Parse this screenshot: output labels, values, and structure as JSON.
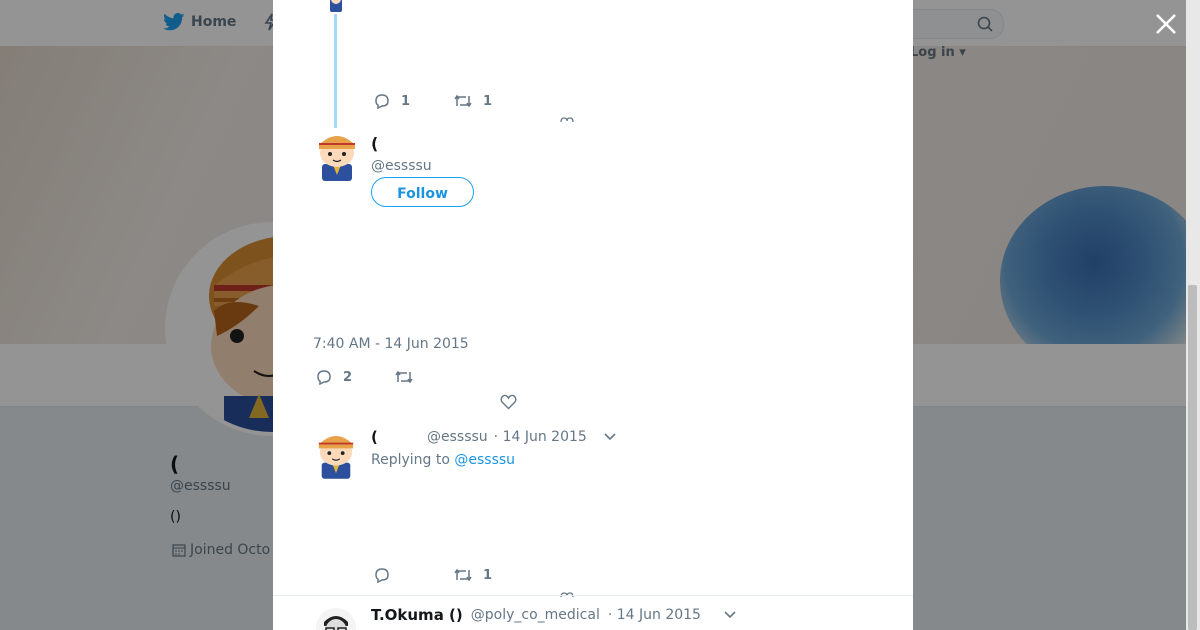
{
  "background": {
    "nav": {
      "home_label": "Home",
      "login_label": "Log in"
    },
    "profile": {
      "name": "(",
      "handle": "@essssu",
      "bio": "()",
      "joined": "Joined Octo"
    }
  },
  "thread": {
    "previous_tweet": {
      "reply_count": "1",
      "retweet_count": "1"
    },
    "main_tweet": {
      "name": "(",
      "handle": "@essssu",
      "follow_label": "Follow",
      "text_line_1": "",
      "text_line_2": "",
      "text_line_3": "",
      "timestamp": "7:40 AM - 14 Jun 2015",
      "reply_count": "2"
    },
    "reply_tweet": {
      "name": "(",
      "handle": "@essssu",
      "date": "· 14 Jun 2015",
      "replying_prefix": "Replying to",
      "replying_handle": "@essssu",
      "retweet_count": "1"
    },
    "third_tweet": {
      "name": "T.Okuma ()",
      "handle": "@poly_co_medical",
      "date": "· 14 Jun 2015"
    }
  },
  "colors": {
    "accent": "#1da1f2",
    "thread_line": "#a4d9f9",
    "muted": "#657786"
  }
}
